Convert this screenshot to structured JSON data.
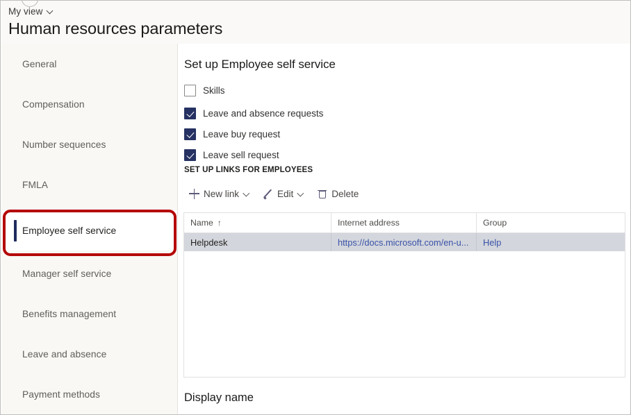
{
  "header": {
    "view_selector_label": "My view",
    "view_selector_icon": "chevron-down-icon",
    "page_title": "Human resources parameters"
  },
  "sidebar": {
    "items": [
      {
        "label": "General",
        "selected": false
      },
      {
        "label": "Compensation",
        "selected": false
      },
      {
        "label": "Number sequences",
        "selected": false
      },
      {
        "label": "FMLA",
        "selected": false
      },
      {
        "label": "Employee self service",
        "selected": true
      },
      {
        "label": "Manager self service",
        "selected": false
      },
      {
        "label": "Benefits management",
        "selected": false
      },
      {
        "label": "Leave and absence",
        "selected": false
      },
      {
        "label": "Payment methods",
        "selected": false
      }
    ]
  },
  "annotation": {
    "color": "#b50808",
    "target": "Employee self service"
  },
  "content": {
    "section_title": "Set up Employee self service",
    "checkboxes": [
      {
        "label": "Skills",
        "checked": false
      },
      {
        "label": "Leave and absence requests",
        "checked": true
      },
      {
        "label": "Leave buy request",
        "checked": true
      },
      {
        "label": "Leave sell request",
        "checked": true
      }
    ],
    "subsection_title": "SET UP LINKS FOR EMPLOYEES",
    "toolbar": [
      {
        "label": "New link",
        "icon": "plus-icon",
        "has_chevron": true
      },
      {
        "label": "Edit",
        "icon": "pencil-icon",
        "has_chevron": true
      },
      {
        "label": "Delete",
        "icon": "trash-icon",
        "has_chevron": false
      }
    ],
    "grid": {
      "columns": [
        {
          "label": "Name",
          "sort": "↑"
        },
        {
          "label": "Internet address",
          "sort": ""
        },
        {
          "label": "Group",
          "sort": ""
        }
      ],
      "rows": [
        {
          "name": "Helpdesk",
          "internet_address": "https://docs.microsoft.com/en-u...",
          "group": "Help"
        }
      ]
    },
    "display_name_label": "Display name"
  },
  "colors": {
    "accent_navy": "#253162",
    "selected_row": "#d3d6dc",
    "link": "#3a52a8",
    "sidebar_bg": "#f9f8f4",
    "annotation_red": "#b50808"
  }
}
